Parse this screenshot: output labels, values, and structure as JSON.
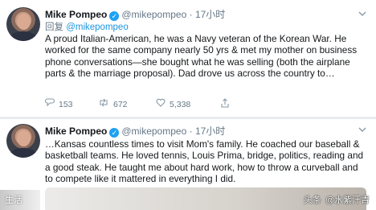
{
  "tweets": [
    {
      "author_name": "Mike Pompeo",
      "verified_mark": "✓",
      "handle": "@mikepompeo",
      "separator": "·",
      "time": "17小时",
      "reply_prefix": "回复",
      "reply_handle": "@mikepompeo",
      "body": "A proud Italian-American, he was a Navy veteran of the Korean War. He worked for the same company nearly 50 yrs & met my mother on business phone conversations—she bought what he was selling (both the airplane parts & the marriage proposal). Dad drove us across the country to…",
      "replies": "153",
      "retweets": "672",
      "likes": "5,338"
    },
    {
      "author_name": "Mike Pompeo",
      "verified_mark": "✓",
      "handle": "@mikepompeo",
      "separator": "·",
      "time": "17小时",
      "body": "…Kansas countless times to visit Mom's family. He coached our baseball & basketball teams. He loved tennis, Louis Prima, bridge, politics, reading and a good steak. He taught me about hard work, how to throw a curveball and to compete like it mattered in everything I did."
    }
  ],
  "icons": {
    "reply": "reply-icon",
    "retweet": "retweet-icon",
    "like": "heart-icon",
    "share": "share-icon",
    "menu": "chevron-down-icon"
  },
  "watermark": {
    "left": "生活",
    "right_prefix": "头条",
    "right_account": "@水紫汗青"
  },
  "colors": {
    "link_blue": "#1b95e0",
    "verified_blue": "#1da1f2",
    "secondary_text": "#657786"
  }
}
